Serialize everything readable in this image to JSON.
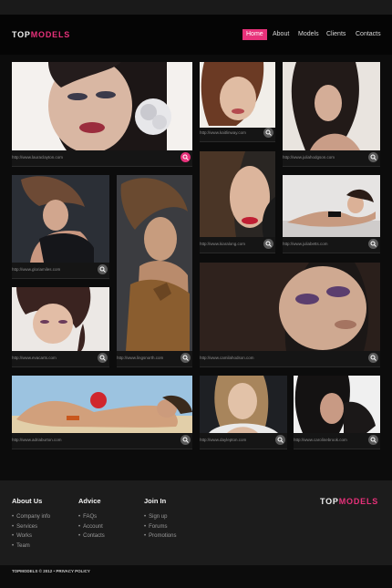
{
  "brand": {
    "top": "TOP",
    "models": "MODELS"
  },
  "nav": {
    "items": [
      {
        "label": "Home",
        "active": true
      },
      {
        "label": "About",
        "active": false
      },
      {
        "label": "Models",
        "active": false
      },
      {
        "label": "Clients",
        "active": false
      },
      {
        "label": "Contacts",
        "active": false
      }
    ]
  },
  "gallery": [
    {
      "url": "http://www.lauraclayton.com",
      "zoom": "magnify-icon",
      "highlighted": true
    },
    {
      "url": "http://www.kaitlinway.com",
      "zoom": "magnify-icon"
    },
    {
      "url": "http://www.juliahodgson.com",
      "zoom": "magnify-icon"
    },
    {
      "url": "http://www.kiaralong.com",
      "zoom": "magnify-icon"
    },
    {
      "url": "http://www.juliabetts.com",
      "zoom": "magnify-icon"
    },
    {
      "url": "http://www.gloriamiles.com",
      "zoom": "magnify-icon"
    },
    {
      "url": "http://www.evacarts.com",
      "zoom": "magnify-icon"
    },
    {
      "url": "http://www.lingsnorth.com",
      "zoom": "magnify-icon"
    },
    {
      "url": "http://www.camilahodson.com",
      "zoom": "magnify-icon"
    },
    {
      "url": "http://www.adriaburton.com",
      "zoom": "magnify-icon"
    },
    {
      "url": "http://www.daylepton.com",
      "zoom": "magnify-icon"
    },
    {
      "url": "http://www.carolinebrook.com",
      "zoom": "magnify-icon"
    }
  ],
  "footer": {
    "about": {
      "title": "About Us",
      "links": [
        "Company info",
        "Services",
        "Works",
        "Team"
      ]
    },
    "advice": {
      "title": "Advice",
      "links": [
        "FAQs",
        "Account",
        "Contacts"
      ]
    },
    "join": {
      "title": "Join In",
      "links": [
        "Sign up",
        "Forums",
        "Promotions"
      ]
    },
    "copyright": "TOPMODELS © 2012 • PRIVACY POLICY"
  },
  "colors": {
    "accent": "#e8317a",
    "background": "#0c0c0c",
    "footer": "#1c1c1c"
  }
}
